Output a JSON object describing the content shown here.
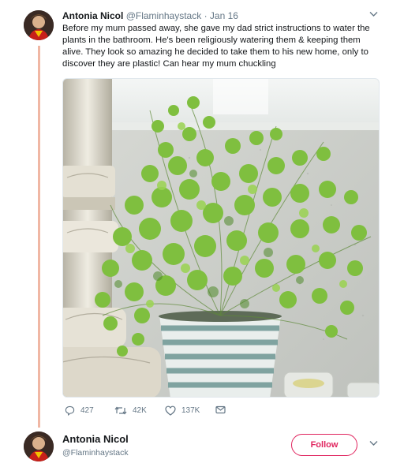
{
  "tweet": {
    "author_name": "Antonia Nicol",
    "author_handle": "@Flaminhaystack",
    "separator": "·",
    "date": "Jan 16",
    "text": "Before my mum passed away, she gave my dad strict instructions to water the plants in the bathroom. He's been religiously watering them & keeping them alive. They look so amazing he decided to take them to his new home, only to discover they are plastic! Can hear my mum chuckling",
    "menu_icon": "chevron-down-icon",
    "photo": "maidenhair fern in striped pot"
  },
  "actions": {
    "reply_count": "427",
    "retweet_count": "42K",
    "like_count": "137K",
    "reply_icon": "reply-icon",
    "retweet_icon": "retweet-icon",
    "like_icon": "heart-icon",
    "dm_icon": "envelope-icon"
  },
  "author_card": {
    "name": "Antonia Nicol",
    "handle": "@Flaminhaystack",
    "follow_label": "Follow",
    "menu_icon": "chevron-down-icon"
  },
  "colors": {
    "thread_line": "#f0b7a4",
    "follow_accent": "#e0245e",
    "secondary_text": "#657786"
  }
}
